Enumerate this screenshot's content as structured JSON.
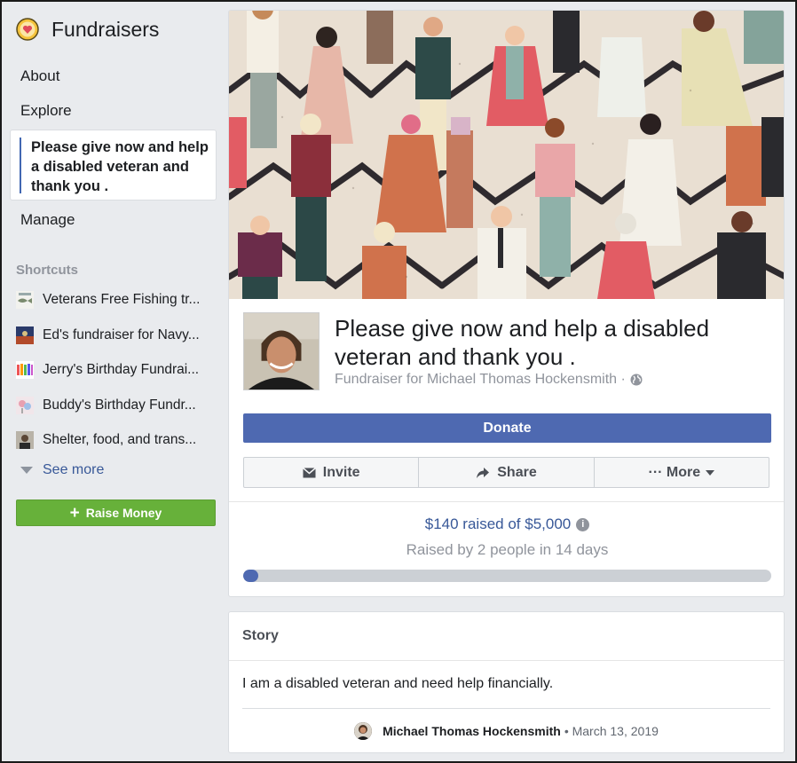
{
  "sidebar": {
    "title": "Fundraisers",
    "nav": {
      "about": "About",
      "explore": "Explore",
      "active": "Please give now and help a disabled veteran and thank you .",
      "manage": "Manage"
    },
    "shortcuts_heading": "Shortcuts",
    "shortcuts": [
      {
        "label": "Veterans Free Fishing tr...",
        "thumb": "fishing-thumbnail"
      },
      {
        "label": "Ed's fundraiser for Navy...",
        "thumb": "navy-thumbnail"
      },
      {
        "label": "Jerry's Birthday Fundrai...",
        "thumb": "birthday-thumbnail"
      },
      {
        "label": "Buddy's Birthday Fundr...",
        "thumb": "birthday-thumbnail"
      },
      {
        "label": "Shelter, food, and trans...",
        "thumb": "person-thumbnail"
      }
    ],
    "see_more": "See more",
    "raise_money": "Raise Money"
  },
  "fundraiser": {
    "title": "Please give now and help a disabled veteran and thank you .",
    "subtitle": "Fundraiser for Michael Thomas Hockensmith ·",
    "donate": "Donate",
    "actions": {
      "invite": "Invite",
      "share": "Share",
      "more": "··· More"
    },
    "raised_text": "$140 raised of $5,000",
    "raised_by": "Raised by 2 people in 14 days",
    "progress_fraction": 0.028
  },
  "story": {
    "heading": "Story",
    "body": "I am a disabled veteran and need help financially.",
    "author": "Michael Thomas Hockensmith",
    "date": "• March 13, 2019"
  },
  "colors": {
    "accent": "#4e69b1",
    "link": "#385898",
    "raise_money": "#67b13a",
    "page_bg": "#e9ebee"
  }
}
